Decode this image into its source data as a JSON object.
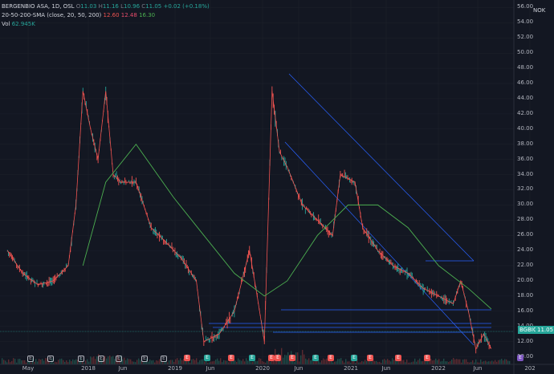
{
  "legend": {
    "symbol": "BERGENBIO ASA, 1D, OSL",
    "open_label": "O",
    "open": "11.03",
    "high_label": "H",
    "high": "11.16",
    "low_label": "L",
    "low": "10.96",
    "close_label": "C",
    "close": "11.05",
    "change": "+0.02 (+0.18%)",
    "sma_label": "20-50-200-SMA (close, 20, 50, 200)",
    "sma20": "12.60",
    "sma50": "12.48",
    "sma200": "16.30",
    "vol_label": "Vol",
    "vol": "62.945K"
  },
  "currency": "NOK",
  "price_tag": {
    "ticker": "BGBIO",
    "value": "11.05"
  },
  "y_ticks": [
    "56.00",
    "54.00",
    "52.00",
    "50.00",
    "48.00",
    "46.00",
    "44.00",
    "42.00",
    "40.00",
    "38.00",
    "36.00",
    "34.00",
    "32.00",
    "30.00",
    "28.00",
    "26.00",
    "24.00",
    "22.00",
    "20.00",
    "18.00",
    "16.00",
    "14.00",
    "12.00",
    "10.00"
  ],
  "x_ticks": [
    "May",
    "2018",
    "Jun",
    "2019",
    "Jun",
    "2020",
    "Jun",
    "2021",
    "Jun",
    "2022",
    "Jun",
    "202"
  ],
  "colors": {
    "bg": "#131722",
    "up": "#26a69a",
    "down": "#ef5350",
    "sma20": "#ef5350",
    "sma50": "#e84c6b",
    "sma200": "#4caf50",
    "lines": "#2962ff"
  },
  "events": [
    {
      "type": "E",
      "label": "E"
    },
    {
      "type": "E",
      "label": "E"
    },
    {
      "type": "E",
      "label": "E"
    },
    {
      "type": "E",
      "label": "E"
    },
    {
      "type": "E",
      "label": "E"
    },
    {
      "type": "E",
      "label": "E"
    },
    {
      "type": "E",
      "label": "E"
    },
    {
      "type": "D",
      "label": "E"
    },
    {
      "type": "Dg",
      "label": "E"
    },
    {
      "type": "D",
      "label": "E"
    },
    {
      "type": "Dg",
      "label": "E"
    },
    {
      "type": "D",
      "label": "E"
    },
    {
      "type": "D",
      "label": "E"
    },
    {
      "type": "D",
      "label": "E"
    },
    {
      "type": "Dg",
      "label": "E"
    },
    {
      "type": "D",
      "label": "E"
    },
    {
      "type": "Dg",
      "label": "E"
    },
    {
      "type": "D",
      "label": "E"
    },
    {
      "type": "D",
      "label": "E"
    },
    {
      "type": "D",
      "label": "E"
    },
    {
      "type": "S",
      "label": "E"
    }
  ],
  "chart_data": {
    "type": "line",
    "title": "BERGENBIO ASA, 1D, OSL",
    "ylim": [
      9,
      57
    ],
    "series": [
      {
        "name": "BERGENBIO ASA",
        "x": [
          "2017-05",
          "2017-07",
          "2017-09",
          "2017-11",
          "2018-01",
          "2018-02",
          "2018-03",
          "2018-04",
          "2018-05",
          "2018-06",
          "2018-07",
          "2018-08",
          "2018-10",
          "2018-12",
          "2019-02",
          "2019-04",
          "2019-06",
          "2019-07",
          "2019-09",
          "2019-11",
          "2020-01",
          "2020-02",
          "2020-03",
          "2020-04",
          "2020-05",
          "2020-06",
          "2020-08",
          "2020-10",
          "2020-12",
          "2021-01",
          "2021-03",
          "2021-04",
          "2021-06",
          "2021-08",
          "2021-10",
          "2021-12",
          "2022-02",
          "2022-04",
          "2022-05",
          "2022-06",
          "2022-07",
          "2022-08",
          "2022-09"
        ],
        "values": [
          24,
          21,
          19.5,
          20,
          22,
          30,
          45,
          40,
          36,
          45,
          34,
          33,
          33,
          27,
          25,
          23,
          20,
          12,
          13,
          16,
          24,
          18,
          12,
          45,
          37,
          35,
          30,
          28,
          26,
          34,
          33,
          27,
          24,
          22,
          21,
          19,
          18,
          17,
          20,
          16,
          11,
          13,
          11.05
        ]
      },
      {
        "name": "SMA 200",
        "x": [
          "2018-03",
          "2018-06",
          "2018-10",
          "2019-03",
          "2019-07",
          "2019-11",
          "2020-03",
          "2020-06",
          "2020-10",
          "2021-02",
          "2021-06",
          "2021-10",
          "2022-02",
          "2022-06",
          "2022-09"
        ],
        "values": [
          22,
          33,
          38,
          31,
          26,
          21,
          18,
          20,
          26,
          30,
          30,
          27,
          22,
          19,
          16.3
        ]
      }
    ]
  }
}
